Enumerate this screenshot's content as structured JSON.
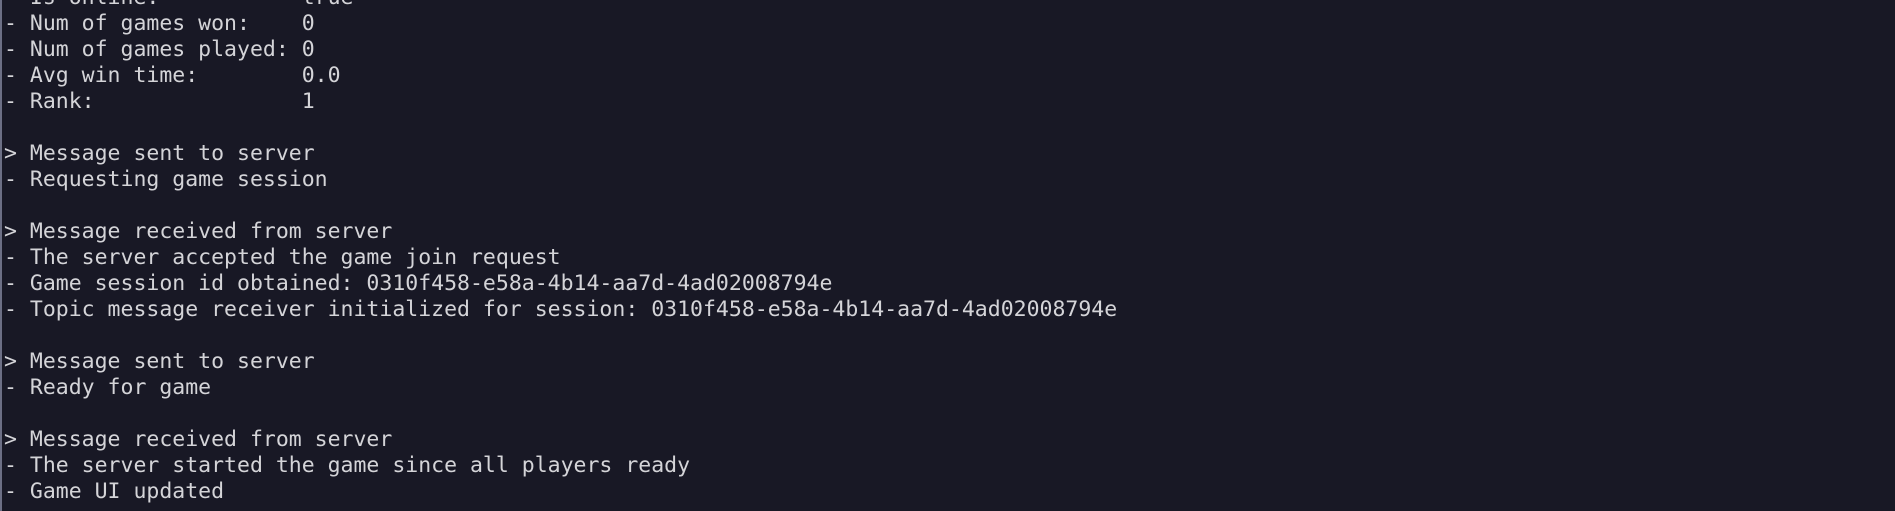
{
  "terminal": {
    "lines": [
      "- Is online:           true",
      "- Num of games won:    0",
      "- Num of games played: 0",
      "- Avg win time:        0.0",
      "- Rank:                1",
      "",
      "> Message sent to server",
      "- Requesting game session",
      "",
      "> Message received from server",
      "- The server accepted the game join request",
      "- Game session id obtained: 0310f458-e58a-4b14-aa7d-4ad02008794e",
      "- Topic message receiver initialized for session: 0310f458-e58a-4b14-aa7d-4ad02008794e",
      "",
      "> Message sent to server",
      "- Ready for game",
      "",
      "> Message received from server",
      "- The server started the game since all players ready",
      "- Game UI updated"
    ]
  }
}
